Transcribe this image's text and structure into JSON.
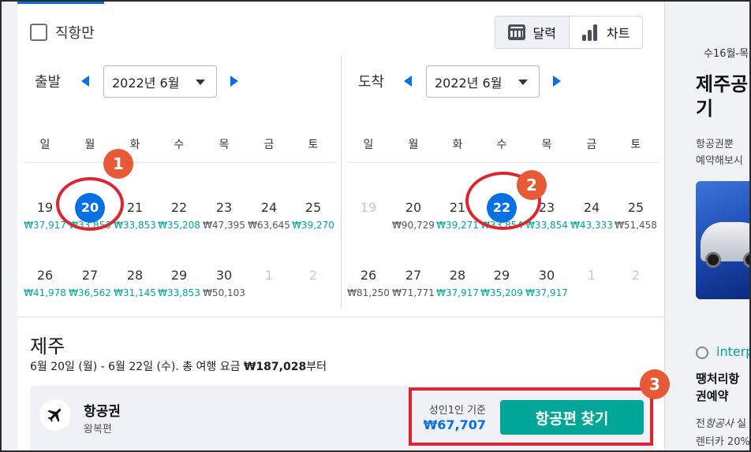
{
  "filters": {
    "direct_only": "직항만"
  },
  "view_toggle": {
    "calendar": "달력",
    "chart": "차트"
  },
  "departure": {
    "label": "출발",
    "month": "2022년 6월",
    "weekdays": [
      "일",
      "월",
      "화",
      "수",
      "목",
      "금",
      "토"
    ],
    "weeks": [
      [
        {
          "day": "19",
          "price": "₩37,917",
          "cheap": true
        },
        {
          "day": "20",
          "price": "₩33,853",
          "cheap": true,
          "selected": true
        },
        {
          "day": "21",
          "price": "₩33,853",
          "cheap": true
        },
        {
          "day": "22",
          "price": "₩35,208",
          "cheap": true
        },
        {
          "day": "23",
          "price": "₩47,395",
          "cheap": false
        },
        {
          "day": "24",
          "price": "₩63,645",
          "cheap": false
        },
        {
          "day": "25",
          "price": "₩39,270",
          "cheap": true
        }
      ],
      [
        {
          "day": "26",
          "price": "₩41,978",
          "cheap": true
        },
        {
          "day": "27",
          "price": "₩36,562",
          "cheap": true
        },
        {
          "day": "28",
          "price": "₩31,145",
          "cheap": true
        },
        {
          "day": "29",
          "price": "₩33,853",
          "cheap": true
        },
        {
          "day": "30",
          "price": "₩50,103",
          "cheap": false
        },
        {
          "day": "1",
          "price": "",
          "dim": true
        },
        {
          "day": "2",
          "price": "",
          "dim": true
        }
      ]
    ]
  },
  "arrival": {
    "label": "도착",
    "month": "2022년 6월",
    "weekdays": [
      "일",
      "월",
      "화",
      "수",
      "목",
      "금",
      "토"
    ],
    "weeks": [
      [
        {
          "day": "19",
          "price": "",
          "dim": true
        },
        {
          "day": "20",
          "price": "₩90,729",
          "cheap": false
        },
        {
          "day": "21",
          "price": "₩39,271",
          "cheap": true
        },
        {
          "day": "22",
          "price": "₩33,854",
          "cheap": true,
          "selected": true
        },
        {
          "day": "23",
          "price": "₩33,854",
          "cheap": true
        },
        {
          "day": "24",
          "price": "₩43,333",
          "cheap": true
        },
        {
          "day": "25",
          "price": "₩51,458",
          "cheap": false
        }
      ],
      [
        {
          "day": "26",
          "price": "₩81,250",
          "cheap": false
        },
        {
          "day": "27",
          "price": "₩71,771",
          "cheap": false
        },
        {
          "day": "28",
          "price": "₩37,917",
          "cheap": true
        },
        {
          "day": "29",
          "price": "₩35,209",
          "cheap": true
        },
        {
          "day": "30",
          "price": "₩37,917",
          "cheap": true
        },
        {
          "day": "1",
          "price": "",
          "dim": true
        },
        {
          "day": "2",
          "price": "",
          "dim": true
        }
      ]
    ]
  },
  "destination": {
    "title": "제주",
    "summary_prefix": "6월 20일 (월) - 6월 22일 (수). 총 여행 요금 ",
    "summary_total": "₩187,028",
    "summary_suffix": "부터"
  },
  "flight": {
    "title": "항공권",
    "subtitle": "왕복편",
    "price_note": "성인1인 기준",
    "price": "₩67,707",
    "button": "항공편 찾기"
  },
  "annotations": [
    "1",
    "2",
    "3"
  ],
  "side": {
    "pill": "수16월-목",
    "headline": "제주공\n기",
    "text1": "항공권뿐",
    "text2": "예약해보시",
    "link": "interp",
    "headline2": "땡처리항\n권예약",
    "text3_a": "전",
    "text3_b": "항공사",
    "text3_c": " 실",
    "text4": "렌터카 20%"
  },
  "colors": {
    "accent": "#0770e3",
    "cheap_price": "#00a698",
    "cta": "#00a698",
    "annotation_ring": "#dc2530",
    "annotation_badge": "#e85a37"
  }
}
